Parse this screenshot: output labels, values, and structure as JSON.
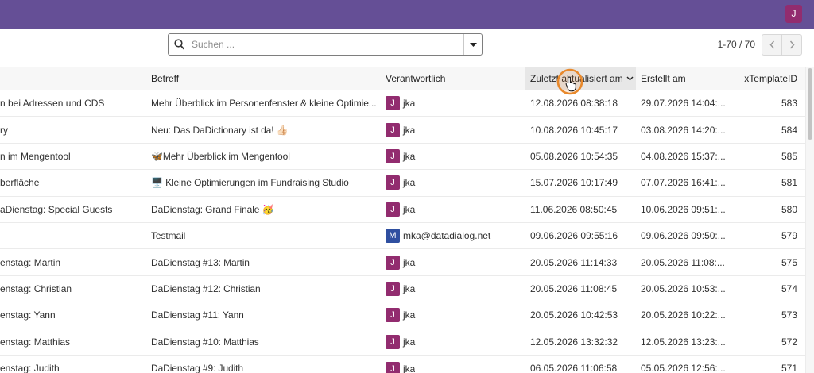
{
  "topbar": {
    "background": "#654f96",
    "user_avatar": {
      "initial": "J",
      "color": "#922c6f"
    }
  },
  "toolbar": {
    "search": {
      "icon": "search-icon",
      "placeholder": "Suchen ...",
      "value": "",
      "dropdown_icon": "caret-down-icon"
    },
    "pagination": {
      "range_text": "1-70 / 70",
      "prev_icon": "chevron-left-icon",
      "next_icon": "chevron-right-icon"
    }
  },
  "table": {
    "columns": [
      {
        "label": ""
      },
      {
        "label": "Betreff"
      },
      {
        "label": "Verantwortlich"
      },
      {
        "label": "Zuletzt aktualisiert am",
        "sort_icon": "sort-chevron-down-icon",
        "highlight": "#e7e7e7"
      },
      {
        "label": "Erstellt am"
      },
      {
        "label": "xTemplateID"
      }
    ],
    "rows": [
      {
        "first_col": "n bei Adressen und CDS",
        "subject": "Mehr Überblick im Personenfenster & kleine Optimie...",
        "owner": {
          "initial": "J",
          "name": "jka",
          "color": "#922c6f"
        },
        "updated": "12.08.2026 08:38:18",
        "created": "29.07.2026 14:04:...",
        "id": "583"
      },
      {
        "first_col": "ry",
        "subject": "Neu: Das DaDictionary ist da! 👍🏻",
        "owner": {
          "initial": "J",
          "name": "jka",
          "color": "#922c6f"
        },
        "updated": "10.08.2026 10:45:17",
        "created": "03.08.2026 14:20:...",
        "id": "584"
      },
      {
        "first_col": "n im Mengentool",
        "subject": "🦋Mehr Überblick im Mengentool",
        "owner": {
          "initial": "J",
          "name": "jka",
          "color": "#922c6f"
        },
        "updated": "05.08.2026 10:54:35",
        "created": "04.08.2026 15:37:...",
        "id": "585"
      },
      {
        "first_col": "berfläche",
        "subject": "🖥️ Kleine Optimierungen im Fundraising Studio",
        "owner": {
          "initial": "J",
          "name": "jka",
          "color": "#922c6f"
        },
        "updated": "15.07.2026 10:17:49",
        "created": "07.07.2026 16:41:...",
        "id": "581"
      },
      {
        "first_col": "aDienstag: Special Guests",
        "subject": "DaDienstag: Grand Finale 🥳",
        "owner": {
          "initial": "J",
          "name": "jka",
          "color": "#922c6f"
        },
        "updated": "11.06.2026 08:50:45",
        "created": "10.06.2026 09:51:...",
        "id": "580"
      },
      {
        "first_col": "",
        "subject": "Testmail",
        "owner": {
          "initial": "M",
          "name": "mka@datadialog.net",
          "color": "#2f4fa0"
        },
        "updated": "09.06.2026 09:55:16",
        "created": "09.06.2026 09:50:...",
        "id": "579"
      },
      {
        "first_col": "enstag: Martin",
        "subject": "DaDienstag #13: Martin",
        "owner": {
          "initial": "J",
          "name": "jka",
          "color": "#922c6f"
        },
        "updated": "20.05.2026 11:14:33",
        "created": "20.05.2026 11:08:...",
        "id": "575"
      },
      {
        "first_col": "enstag: Christian",
        "subject": "DaDienstag #12: Christian",
        "owner": {
          "initial": "J",
          "name": "jka",
          "color": "#922c6f"
        },
        "updated": "20.05.2026 11:08:45",
        "created": "20.05.2026 10:53:...",
        "id": "574"
      },
      {
        "first_col": "enstag: Yann",
        "subject": "DaDienstag #11: Yann",
        "owner": {
          "initial": "J",
          "name": "jka",
          "color": "#922c6f"
        },
        "updated": "20.05.2026 10:42:53",
        "created": "20.05.2026 10:22:...",
        "id": "573"
      },
      {
        "first_col": "enstag: Matthias",
        "subject": "DaDienstag #10: Matthias",
        "owner": {
          "initial": "J",
          "name": "jka",
          "color": "#922c6f"
        },
        "updated": "12.05.2026 13:32:32",
        "created": "12.05.2026 13:23:...",
        "id": "572"
      },
      {
        "first_col": "enstag: Judith",
        "subject": "DaDienstag #9: Judith",
        "owner": {
          "initial": "J",
          "name": "jka",
          "color": "#922c6f"
        },
        "updated": "06.05.2026 11:06:58",
        "created": "05.05.2026 12:56:...",
        "id": "571"
      }
    ]
  },
  "cursor": {
    "icon": "hand-cursor-icon",
    "highlight_color": "#e8892c"
  }
}
